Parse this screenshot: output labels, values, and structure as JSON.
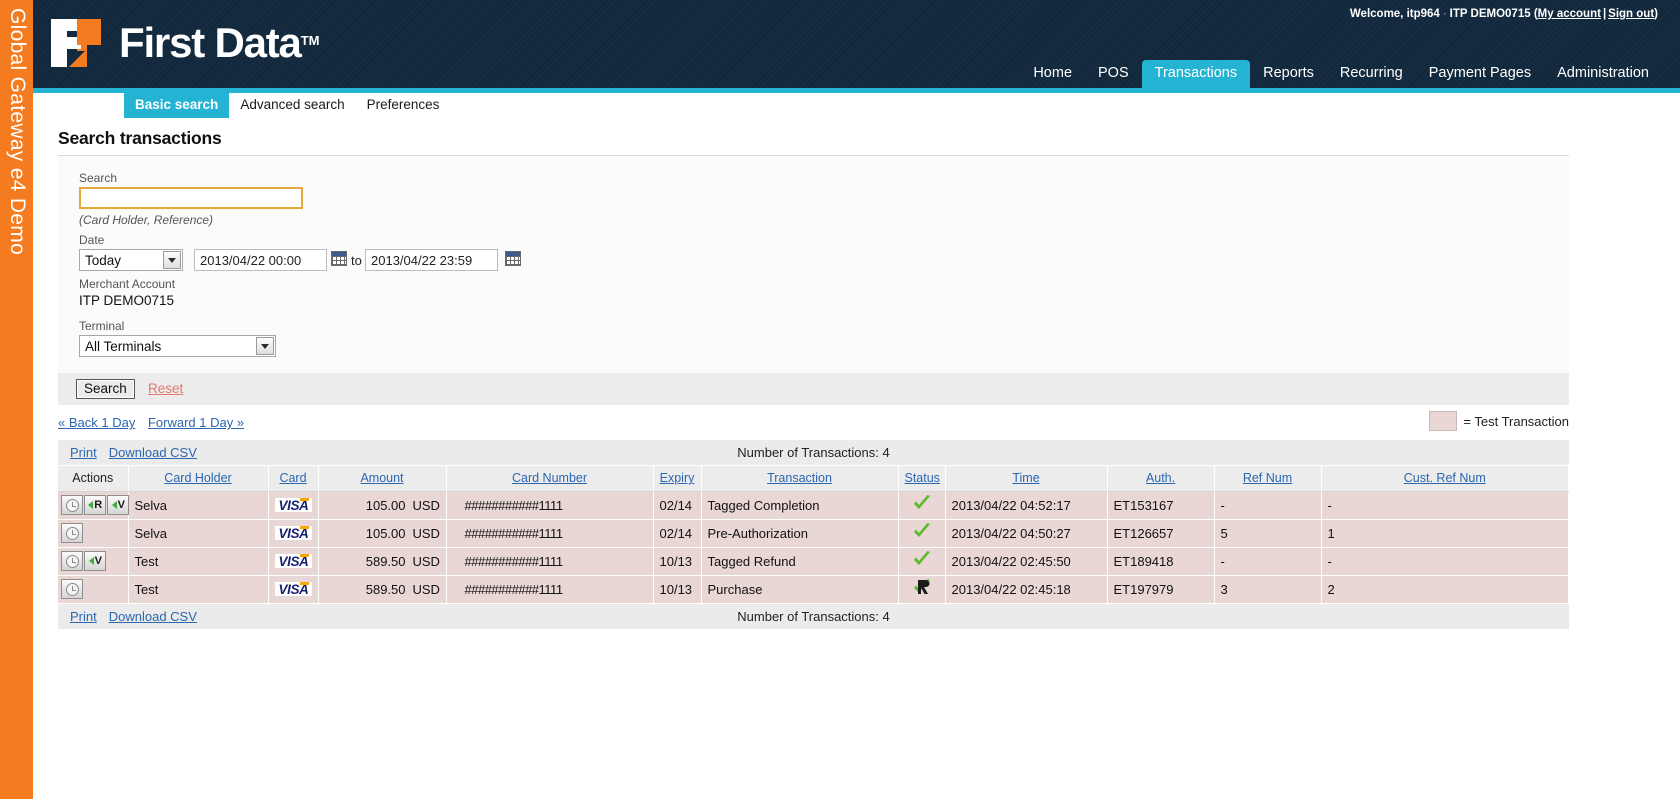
{
  "brand": {
    "rail_text": "Global Gateway e4 Demo",
    "logo_text": "First Data",
    "logo_tm": "TM",
    "accent_teal": "#25b3d4",
    "accent_orange": "#f47b20",
    "header_bg": "#11283d"
  },
  "header": {
    "welcome_prefix": "Welcome, itp964",
    "separator": "·",
    "merchant": "ITP DEMO0715",
    "paren_open": "(",
    "my_account": "My account",
    "pipe": "|",
    "sign_out": "Sign out",
    "paren_close": ")"
  },
  "mainnav": {
    "items": [
      {
        "label": "Home",
        "active": false
      },
      {
        "label": "POS",
        "active": false
      },
      {
        "label": "Transactions",
        "active": true
      },
      {
        "label": "Reports",
        "active": false
      },
      {
        "label": "Recurring",
        "active": false
      },
      {
        "label": "Payment Pages",
        "active": false
      },
      {
        "label": "Administration",
        "active": false
      }
    ]
  },
  "subtabs": {
    "items": [
      {
        "label": "Basic search",
        "active": true
      },
      {
        "label": "Advanced search",
        "active": false
      },
      {
        "label": "Preferences",
        "active": false
      }
    ]
  },
  "page": {
    "title": "Search transactions"
  },
  "form": {
    "search_label": "Search",
    "search_value": "",
    "search_placeholder": "",
    "search_hint": "(Card Holder, Reference)",
    "date_label": "Date",
    "date_preset": "Today",
    "date_from": "2013/04/22 00:00",
    "date_to_label": "to",
    "date_to": "2013/04/22 23:59",
    "calendar_icon": "calendar-icon",
    "merchant_label": "Merchant Account",
    "merchant_value": "ITP DEMO0715",
    "terminal_label": "Terminal",
    "terminal_value": "All Terminals",
    "search_button": "Search",
    "reset_link": "Reset"
  },
  "daynav": {
    "back": "« Back 1 Day",
    "forward": "Forward 1 Day »"
  },
  "legend": {
    "text": "= Test Transaction",
    "swatch_color": "#e8d7d4"
  },
  "toolbar": {
    "print": "Print",
    "download_csv": "Download CSV",
    "count_text": "Number of Transactions: 4"
  },
  "table": {
    "columns": [
      {
        "label": "Actions",
        "link": false
      },
      {
        "label": "Card Holder",
        "link": true
      },
      {
        "label": "Card",
        "link": true
      },
      {
        "label": "Amount",
        "link": true
      },
      {
        "label": "Card Number",
        "link": true
      },
      {
        "label": "Expiry",
        "link": true
      },
      {
        "label": "Transaction",
        "link": true
      },
      {
        "label": "Status",
        "link": true
      },
      {
        "label": "Time",
        "link": true
      },
      {
        "label": "Auth.",
        "link": true
      },
      {
        "label": "Ref Num",
        "link": true
      },
      {
        "label": "Cust. Ref Num",
        "link": true
      }
    ],
    "rows": [
      {
        "actions": [
          "view-icon",
          "refund-icon",
          "void-icon"
        ],
        "card_holder": "Selva",
        "card": "VISA",
        "amount": "105.00",
        "currency": "USD",
        "card_number": "###########1111",
        "expiry": "02/14",
        "transaction": "Tagged Completion",
        "status": "approved-check-icon",
        "time": "2013/04/22 04:52:17",
        "auth": "ET153167",
        "ref_num": "-",
        "cust_ref_num": "-"
      },
      {
        "actions": [
          "view-icon"
        ],
        "card_holder": "Selva",
        "card": "VISA",
        "amount": "105.00",
        "currency": "USD",
        "card_number": "###########1111",
        "expiry": "02/14",
        "transaction": "Pre-Authorization",
        "status": "approved-check-c-icon",
        "time": "2013/04/22 04:50:27",
        "auth": "ET126657",
        "ref_num": "5",
        "cust_ref_num": "1"
      },
      {
        "actions": [
          "view-icon",
          "void-icon"
        ],
        "card_holder": "Test",
        "card": "VISA",
        "amount": "589.50",
        "currency": "USD",
        "card_number": "###########1111",
        "expiry": "10/13",
        "transaction": "Tagged Refund",
        "status": "approved-check-icon",
        "time": "2013/04/22 02:45:50",
        "auth": "ET189418",
        "ref_num": "-",
        "cust_ref_num": "-"
      },
      {
        "actions": [
          "view-icon"
        ],
        "card_holder": "Test",
        "card": "VISA",
        "amount": "589.50",
        "currency": "USD",
        "card_number": "###########1111",
        "expiry": "10/13",
        "transaction": "Purchase",
        "status": "approved-check-r-icon",
        "time": "2013/04/22 02:45:18",
        "auth": "ET197979",
        "ref_num": "3",
        "cust_ref_num": "2"
      }
    ]
  },
  "footer": {
    "print": "Print",
    "download_csv": "Download CSV",
    "count_text": "Number of Transactions: 4"
  }
}
